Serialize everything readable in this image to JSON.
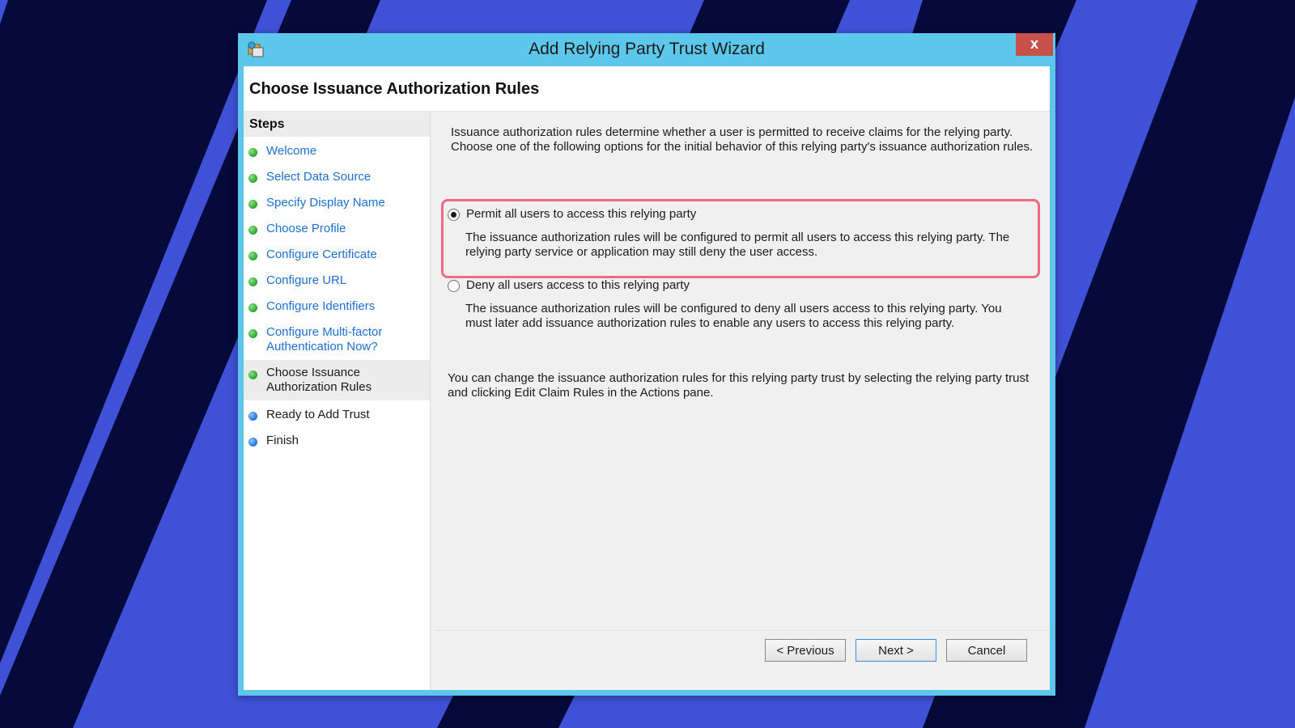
{
  "window": {
    "title": "Add Relying Party Trust Wizard",
    "close_label": "x"
  },
  "header": {
    "page_title": "Choose Issuance Authorization Rules"
  },
  "steps": {
    "heading": "Steps",
    "items": [
      {
        "label": "Welcome",
        "status": "done"
      },
      {
        "label": "Select Data Source",
        "status": "done"
      },
      {
        "label": "Specify Display Name",
        "status": "done"
      },
      {
        "label": "Choose Profile",
        "status": "done"
      },
      {
        "label": "Configure Certificate",
        "status": "done"
      },
      {
        "label": "Configure URL",
        "status": "done"
      },
      {
        "label": "Configure Identifiers",
        "status": "done"
      },
      {
        "label": "Configure Multi-factor Authentication Now?",
        "status": "done"
      },
      {
        "label": "Choose Issuance Authorization Rules",
        "status": "current"
      },
      {
        "label": "Ready to Add Trust",
        "status": "pending"
      },
      {
        "label": "Finish",
        "status": "pending"
      }
    ]
  },
  "content": {
    "intro": "Issuance authorization rules determine whether a user is permitted to receive claims for the relying party. Choose one of the following options for the initial behavior of this relying party's issuance authorization rules.",
    "options": [
      {
        "label": "Permit all users to access this relying party",
        "description": "The issuance authorization rules will be configured to permit all users to access this relying party. The relying party service or application may still deny the user access.",
        "selected": true
      },
      {
        "label": "Deny all users access to this relying party",
        "description": "The issuance authorization rules will be configured to deny all users access to this relying party. You must later add issuance authorization rules to enable any users to access this relying party.",
        "selected": false
      }
    ],
    "note": "You can change the issuance authorization rules for this relying party trust by selecting the relying party trust and clicking Edit Claim Rules in the Actions pane."
  },
  "buttons": {
    "previous": "< Previous",
    "next": "Next >",
    "cancel": "Cancel"
  },
  "colors": {
    "background_blue": "#3f51d6",
    "background_navy": "#050a3a",
    "titlebar": "#5cc7eb",
    "close_button": "#c7504a",
    "highlight": "#f06a80",
    "link": "#1d6fd1",
    "done_dot": "#28a32a",
    "pending_dot": "#1f6fd6"
  }
}
